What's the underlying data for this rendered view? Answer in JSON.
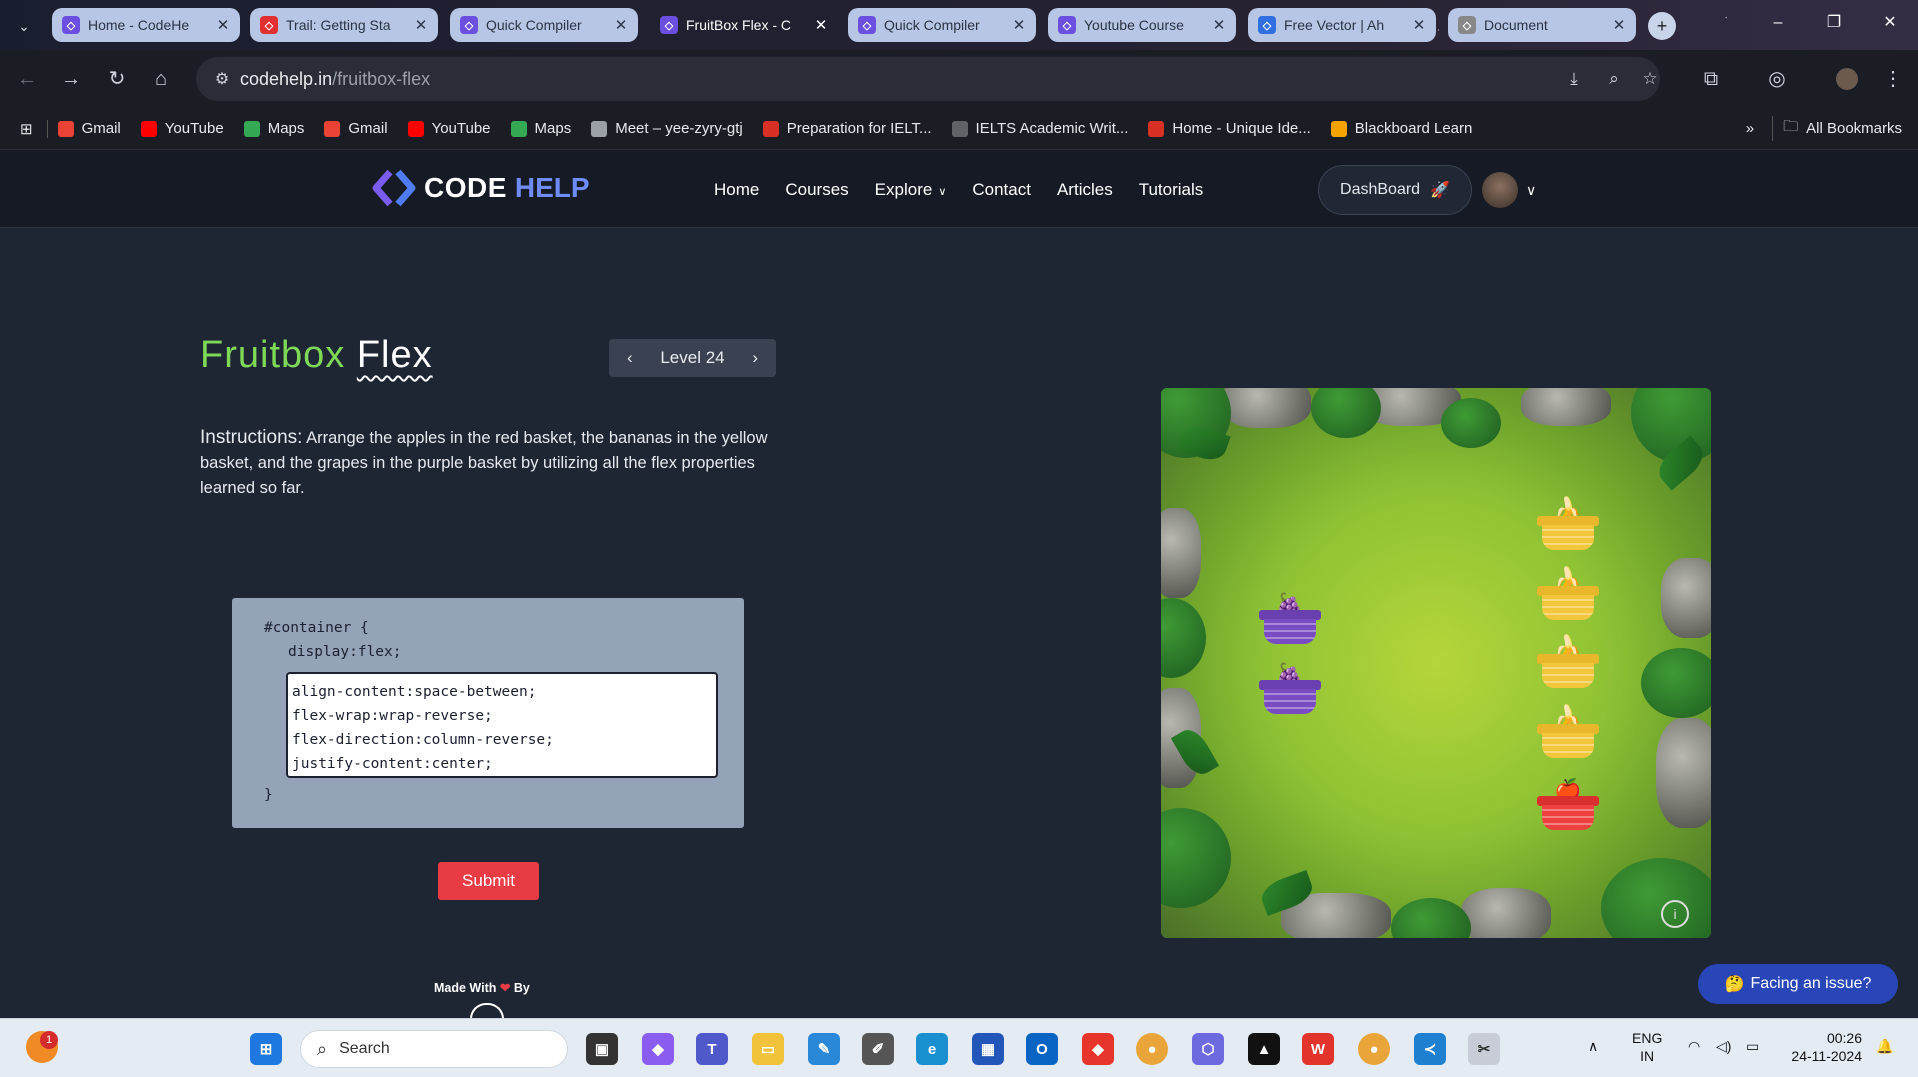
{
  "browser": {
    "tabs": [
      {
        "title": "Home - CodeHe",
        "icon": "codehelp-icon",
        "color": "#6a4fe0"
      },
      {
        "title": "Trail: Getting Sta",
        "icon": "trailhead-icon",
        "color": "#e03030"
      },
      {
        "title": "Quick Compiler",
        "icon": "codehelp-icon",
        "color": "#6a4fe0"
      },
      {
        "title": "FruitBox Flex - C",
        "icon": "codehelp-icon",
        "color": "#6a4fe0",
        "active": true
      },
      {
        "title": "Quick Compiler",
        "icon": "codehelp-icon",
        "color": "#6a4fe0"
      },
      {
        "title": "Youtube Course",
        "icon": "codehelp-icon",
        "color": "#6a4fe0"
      },
      {
        "title": "Free Vector | Ah",
        "icon": "freepik-icon",
        "color": "#2f6fe0"
      },
      {
        "title": "Document",
        "icon": "globe-icon",
        "color": "#888888"
      }
    ],
    "url_domain": "codehelp.in",
    "url_path": "/fruitbox-flex",
    "bookmarks": [
      {
        "label": "Gmail",
        "icon": "gmail-icon",
        "color": "#ea4335"
      },
      {
        "label": "YouTube",
        "icon": "youtube-icon",
        "color": "#ff0000"
      },
      {
        "label": "Maps",
        "icon": "maps-icon",
        "color": "#34a853"
      },
      {
        "label": "Gmail",
        "icon": "gmail-icon",
        "color": "#ea4335"
      },
      {
        "label": "YouTube",
        "icon": "youtube-icon",
        "color": "#ff0000"
      },
      {
        "label": "Maps",
        "icon": "maps-icon",
        "color": "#34a853"
      },
      {
        "label": "Meet – yee-zyry-gtj",
        "icon": "globe-icon",
        "color": "#9aa0a6"
      },
      {
        "label": "Preparation for IELT...",
        "icon": "grid-icon",
        "color": "#d93025"
      },
      {
        "label": "IELTS Academic Writ...",
        "icon": "shield-icon",
        "color": "#5f6368"
      },
      {
        "label": "Home - Unique Ide...",
        "icon": "wifi-icon",
        "color": "#d93025"
      },
      {
        "label": "Blackboard Learn",
        "icon": "blackboard-icon",
        "color": "#f4a300"
      }
    ],
    "all_bookmarks": "All Bookmarks"
  },
  "site": {
    "logo_word1": "CODE",
    "logo_word2": "HELP",
    "nav": [
      "Home",
      "Courses",
      "Explore",
      "Contact",
      "Articles",
      "Tutorials"
    ],
    "dashboard": "DashBoard"
  },
  "game": {
    "title_word1": "Fruitbox",
    "title_word2": "Flex",
    "level_label": "Level",
    "level_number": "24",
    "instructions_label": "Instructions:",
    "instructions_text": "Arrange the apples in the red basket, the bananas in the yellow basket, and the grapes in the purple basket by utilizing all the flex properties learned so far.",
    "code_open": "#container {",
    "code_fixed": "display:flex;",
    "code_input": "align-content:space-between;\nflex-wrap:wrap-reverse;\nflex-direction:column-reverse;\njustify-content:center;",
    "code_close": "}",
    "submit": "Submit",
    "made_with": "Made With",
    "by": "By",
    "issue": "Facing an issue?",
    "colors": {
      "accent_green": "#7ed957",
      "submit_red": "#e93b43",
      "issue_blue": "#2946b8"
    }
  },
  "taskbar": {
    "search_placeholder": "Search",
    "notification_count": "1",
    "lang1": "ENG",
    "lang2": "IN",
    "time": "00:26",
    "date": "24-11-2024"
  }
}
